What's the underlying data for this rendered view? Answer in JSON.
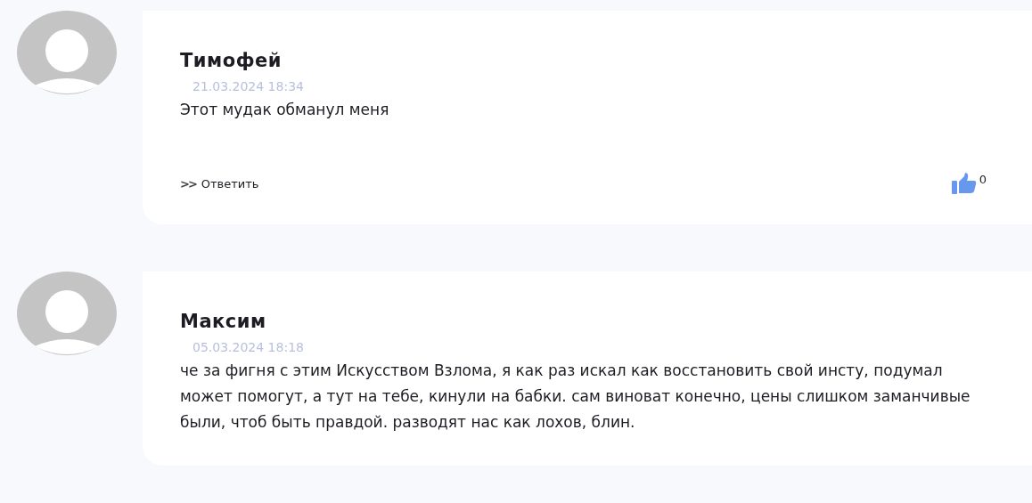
{
  "comments": [
    {
      "author": "Тимофей",
      "date": "21.03.2024 18:34",
      "text": "Этот мудак обманул меня",
      "reply": {
        "icon": ">>",
        "label": "Ответить"
      },
      "likes": "0"
    },
    {
      "author": "Максим",
      "date": "05.03.2024 18:18",
      "text": "че за фигня с этим Искусством Взлома, я как раз искал как восстановить свой инсту, подумал может помогут, а тут на тебе, кинули на бабки. сам виноват конечно, цены слишком заманчивые были, чтоб быть правдой. разводят нас как лохов, блин."
    }
  ]
}
